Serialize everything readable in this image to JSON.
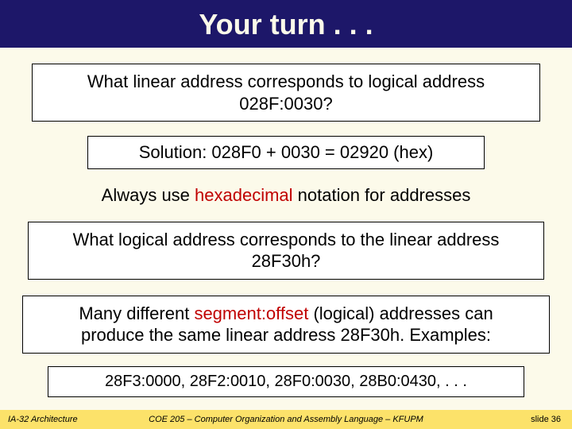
{
  "header": {
    "title": "Your turn . . ."
  },
  "q1": {
    "line1": "What linear address corresponds to logical address",
    "line2": "028F:0030?"
  },
  "solution": "Solution: 028F0 + 0030 = 02920 (hex)",
  "note": {
    "pre": "Always use ",
    "em": "hexadecimal",
    "post": " notation for addresses"
  },
  "q2": {
    "line1": "What logical address corresponds to the linear address",
    "line2": "28F30h?"
  },
  "answer": {
    "line1_pre": "Many different ",
    "line1_em": "segment:offset",
    "line1_post": " (logical) addresses can",
    "line2": "produce the same linear address 28F30h. Examples:"
  },
  "examples": "28F3:0000, 28F2:0010, 28F0:0030, 28B0:0430, . . .",
  "footer": {
    "left": "IA-32 Architecture",
    "center": "COE 205 – Computer Organization and Assembly Language – KFUPM",
    "right": "slide 36"
  }
}
